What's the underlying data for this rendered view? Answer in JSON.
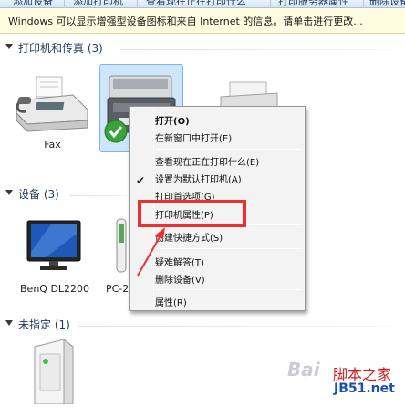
{
  "toolbar": {
    "buttons": [
      "添加设备",
      "添加打印机",
      "查看现在正在打印什么",
      "打印服务器属性",
      "删除设备"
    ]
  },
  "infobar": {
    "text": "Windows 可以显示增强型设备图标和来自 Internet 的信息。请单击进行更改..."
  },
  "sections": [
    {
      "title": "打印机和传真 (3)"
    },
    {
      "title": "设备 (3)"
    },
    {
      "title": "未指定 (1)"
    }
  ],
  "printers": [
    {
      "label": "Fax",
      "icon": "fax-icon"
    },
    {
      "label": "",
      "icon": "multifunction-printer-icon",
      "default": true
    },
    {
      "label": "",
      "icon": "printer-icon"
    }
  ],
  "devices": [
    {
      "label": "BenQ DL2200",
      "icon": "monitor-icon"
    },
    {
      "label": "PC-2",
      "icon": "usb-device-icon"
    }
  ],
  "unspecified": [
    {
      "label": "",
      "icon": "tower-device-icon"
    }
  ],
  "context_menu": {
    "items": [
      {
        "label": "打开(O)",
        "bold": true
      },
      {
        "label": "在新窗口中打开(E)"
      },
      {
        "label": "查看现在正在打印什么(E)"
      },
      {
        "label": "设置为默认打印机(A)",
        "checked": true
      },
      {
        "label": "打印首选项(G)"
      },
      {
        "label": "打印机属性(P)",
        "highlighted_by_red_box": true
      },
      {
        "label": "创建快捷方式(S)"
      },
      {
        "label": "疑难解答(T)"
      },
      {
        "label": "删除设备(V)"
      },
      {
        "label": "属性(R)"
      }
    ]
  },
  "watermark": {
    "logo": "Bai",
    "brand": "脚本之家",
    "site": "JB51.net"
  },
  "colors": {
    "accent_red": "#ef2f2f",
    "selection_blue": "#cfe5fb",
    "infobar_yellow": "#fffde1",
    "section_title": "#1e395b"
  }
}
